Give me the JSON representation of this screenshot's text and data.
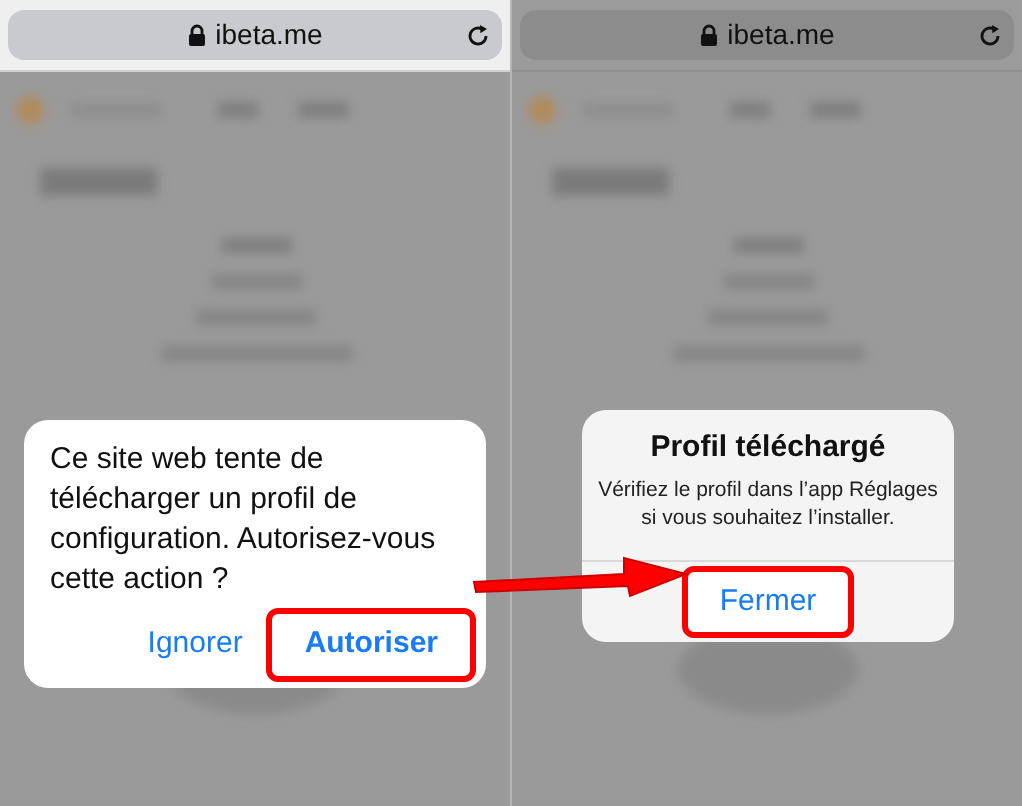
{
  "panels": [
    {
      "address_bar": {
        "url": "ibeta.me",
        "dimmed": false
      },
      "dialog": {
        "kind": "prompt",
        "message": "Ce site web tente de télécharger un profil de configuration. Autorisez-vous cette action ?",
        "buttons": [
          {
            "label": "Ignorer",
            "bold": false,
            "highlighted": false
          },
          {
            "label": "Autoriser",
            "bold": true,
            "highlighted": true
          }
        ]
      }
    },
    {
      "address_bar": {
        "url": "ibeta.me",
        "dimmed": true
      },
      "dialog": {
        "kind": "alert",
        "title": "Profil téléchargé",
        "message": "Vérifiez le profil dans l’app Réglages si vous souhaitez l’installer.",
        "buttons": [
          {
            "label": "Fermer",
            "bold": false,
            "highlighted": true
          }
        ]
      }
    }
  ]
}
